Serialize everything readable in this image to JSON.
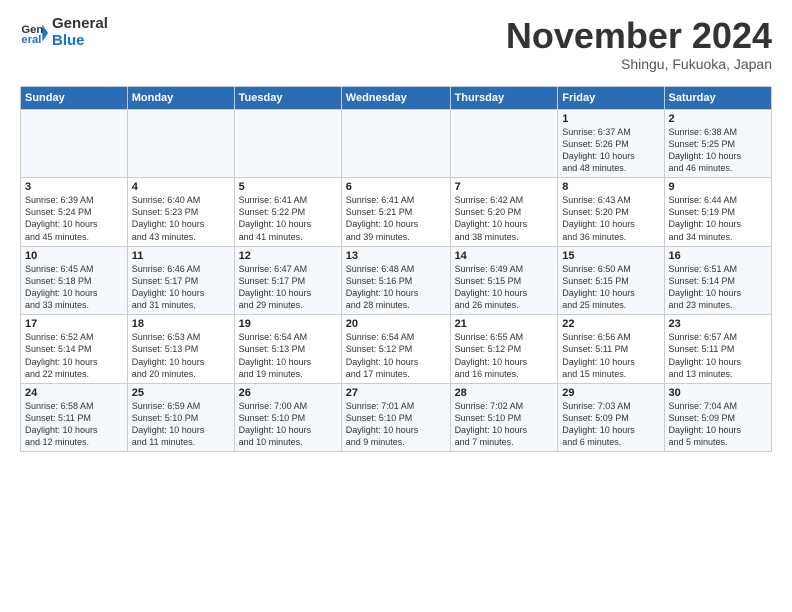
{
  "header": {
    "logo_line1": "General",
    "logo_line2": "Blue",
    "month": "November 2024",
    "location": "Shingu, Fukuoka, Japan"
  },
  "weekdays": [
    "Sunday",
    "Monday",
    "Tuesday",
    "Wednesday",
    "Thursday",
    "Friday",
    "Saturday"
  ],
  "weeks": [
    [
      {
        "day": "",
        "info": ""
      },
      {
        "day": "",
        "info": ""
      },
      {
        "day": "",
        "info": ""
      },
      {
        "day": "",
        "info": ""
      },
      {
        "day": "",
        "info": ""
      },
      {
        "day": "1",
        "info": "Sunrise: 6:37 AM\nSunset: 5:26 PM\nDaylight: 10 hours\nand 48 minutes."
      },
      {
        "day": "2",
        "info": "Sunrise: 6:38 AM\nSunset: 5:25 PM\nDaylight: 10 hours\nand 46 minutes."
      }
    ],
    [
      {
        "day": "3",
        "info": "Sunrise: 6:39 AM\nSunset: 5:24 PM\nDaylight: 10 hours\nand 45 minutes."
      },
      {
        "day": "4",
        "info": "Sunrise: 6:40 AM\nSunset: 5:23 PM\nDaylight: 10 hours\nand 43 minutes."
      },
      {
        "day": "5",
        "info": "Sunrise: 6:41 AM\nSunset: 5:22 PM\nDaylight: 10 hours\nand 41 minutes."
      },
      {
        "day": "6",
        "info": "Sunrise: 6:41 AM\nSunset: 5:21 PM\nDaylight: 10 hours\nand 39 minutes."
      },
      {
        "day": "7",
        "info": "Sunrise: 6:42 AM\nSunset: 5:20 PM\nDaylight: 10 hours\nand 38 minutes."
      },
      {
        "day": "8",
        "info": "Sunrise: 6:43 AM\nSunset: 5:20 PM\nDaylight: 10 hours\nand 36 minutes."
      },
      {
        "day": "9",
        "info": "Sunrise: 6:44 AM\nSunset: 5:19 PM\nDaylight: 10 hours\nand 34 minutes."
      }
    ],
    [
      {
        "day": "10",
        "info": "Sunrise: 6:45 AM\nSunset: 5:18 PM\nDaylight: 10 hours\nand 33 minutes."
      },
      {
        "day": "11",
        "info": "Sunrise: 6:46 AM\nSunset: 5:17 PM\nDaylight: 10 hours\nand 31 minutes."
      },
      {
        "day": "12",
        "info": "Sunrise: 6:47 AM\nSunset: 5:17 PM\nDaylight: 10 hours\nand 29 minutes."
      },
      {
        "day": "13",
        "info": "Sunrise: 6:48 AM\nSunset: 5:16 PM\nDaylight: 10 hours\nand 28 minutes."
      },
      {
        "day": "14",
        "info": "Sunrise: 6:49 AM\nSunset: 5:15 PM\nDaylight: 10 hours\nand 26 minutes."
      },
      {
        "day": "15",
        "info": "Sunrise: 6:50 AM\nSunset: 5:15 PM\nDaylight: 10 hours\nand 25 minutes."
      },
      {
        "day": "16",
        "info": "Sunrise: 6:51 AM\nSunset: 5:14 PM\nDaylight: 10 hours\nand 23 minutes."
      }
    ],
    [
      {
        "day": "17",
        "info": "Sunrise: 6:52 AM\nSunset: 5:14 PM\nDaylight: 10 hours\nand 22 minutes."
      },
      {
        "day": "18",
        "info": "Sunrise: 6:53 AM\nSunset: 5:13 PM\nDaylight: 10 hours\nand 20 minutes."
      },
      {
        "day": "19",
        "info": "Sunrise: 6:54 AM\nSunset: 5:13 PM\nDaylight: 10 hours\nand 19 minutes."
      },
      {
        "day": "20",
        "info": "Sunrise: 6:54 AM\nSunset: 5:12 PM\nDaylight: 10 hours\nand 17 minutes."
      },
      {
        "day": "21",
        "info": "Sunrise: 6:55 AM\nSunset: 5:12 PM\nDaylight: 10 hours\nand 16 minutes."
      },
      {
        "day": "22",
        "info": "Sunrise: 6:56 AM\nSunset: 5:11 PM\nDaylight: 10 hours\nand 15 minutes."
      },
      {
        "day": "23",
        "info": "Sunrise: 6:57 AM\nSunset: 5:11 PM\nDaylight: 10 hours\nand 13 minutes."
      }
    ],
    [
      {
        "day": "24",
        "info": "Sunrise: 6:58 AM\nSunset: 5:11 PM\nDaylight: 10 hours\nand 12 minutes."
      },
      {
        "day": "25",
        "info": "Sunrise: 6:59 AM\nSunset: 5:10 PM\nDaylight: 10 hours\nand 11 minutes."
      },
      {
        "day": "26",
        "info": "Sunrise: 7:00 AM\nSunset: 5:10 PM\nDaylight: 10 hours\nand 10 minutes."
      },
      {
        "day": "27",
        "info": "Sunrise: 7:01 AM\nSunset: 5:10 PM\nDaylight: 10 hours\nand 9 minutes."
      },
      {
        "day": "28",
        "info": "Sunrise: 7:02 AM\nSunset: 5:10 PM\nDaylight: 10 hours\nand 7 minutes."
      },
      {
        "day": "29",
        "info": "Sunrise: 7:03 AM\nSunset: 5:09 PM\nDaylight: 10 hours\nand 6 minutes."
      },
      {
        "day": "30",
        "info": "Sunrise: 7:04 AM\nSunset: 5:09 PM\nDaylight: 10 hours\nand 5 minutes."
      }
    ]
  ]
}
